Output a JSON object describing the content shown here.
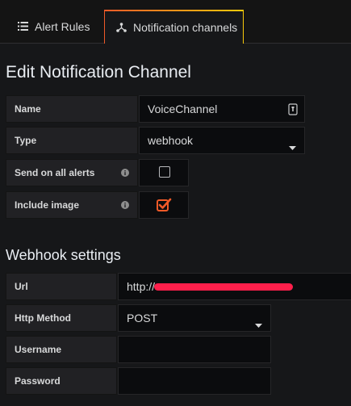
{
  "tabs": {
    "alert_rules": {
      "label": "Alert Rules",
      "icon": "list-icon"
    },
    "notification_channels": {
      "label": "Notification channels",
      "icon": "share-icon",
      "active": true
    }
  },
  "page_title": "Edit Notification Channel",
  "form": {
    "name": {
      "label": "Name",
      "value": "VoiceChannel"
    },
    "type": {
      "label": "Type",
      "value": "webhook"
    },
    "send_on_all_alerts": {
      "label": "Send on all alerts",
      "checked": false
    },
    "include_image": {
      "label": "Include image",
      "checked": true
    }
  },
  "webhook": {
    "title": "Webhook settings",
    "url": {
      "label": "Url",
      "value": "http://"
    },
    "http_method": {
      "label": "Http Method",
      "value": "POST"
    },
    "username": {
      "label": "Username",
      "value": ""
    },
    "password": {
      "label": "Password",
      "value": ""
    }
  },
  "colors": {
    "accent": "#f05a28",
    "gradient_end": "#fbca0a",
    "redaction": "#ff1f4b"
  }
}
